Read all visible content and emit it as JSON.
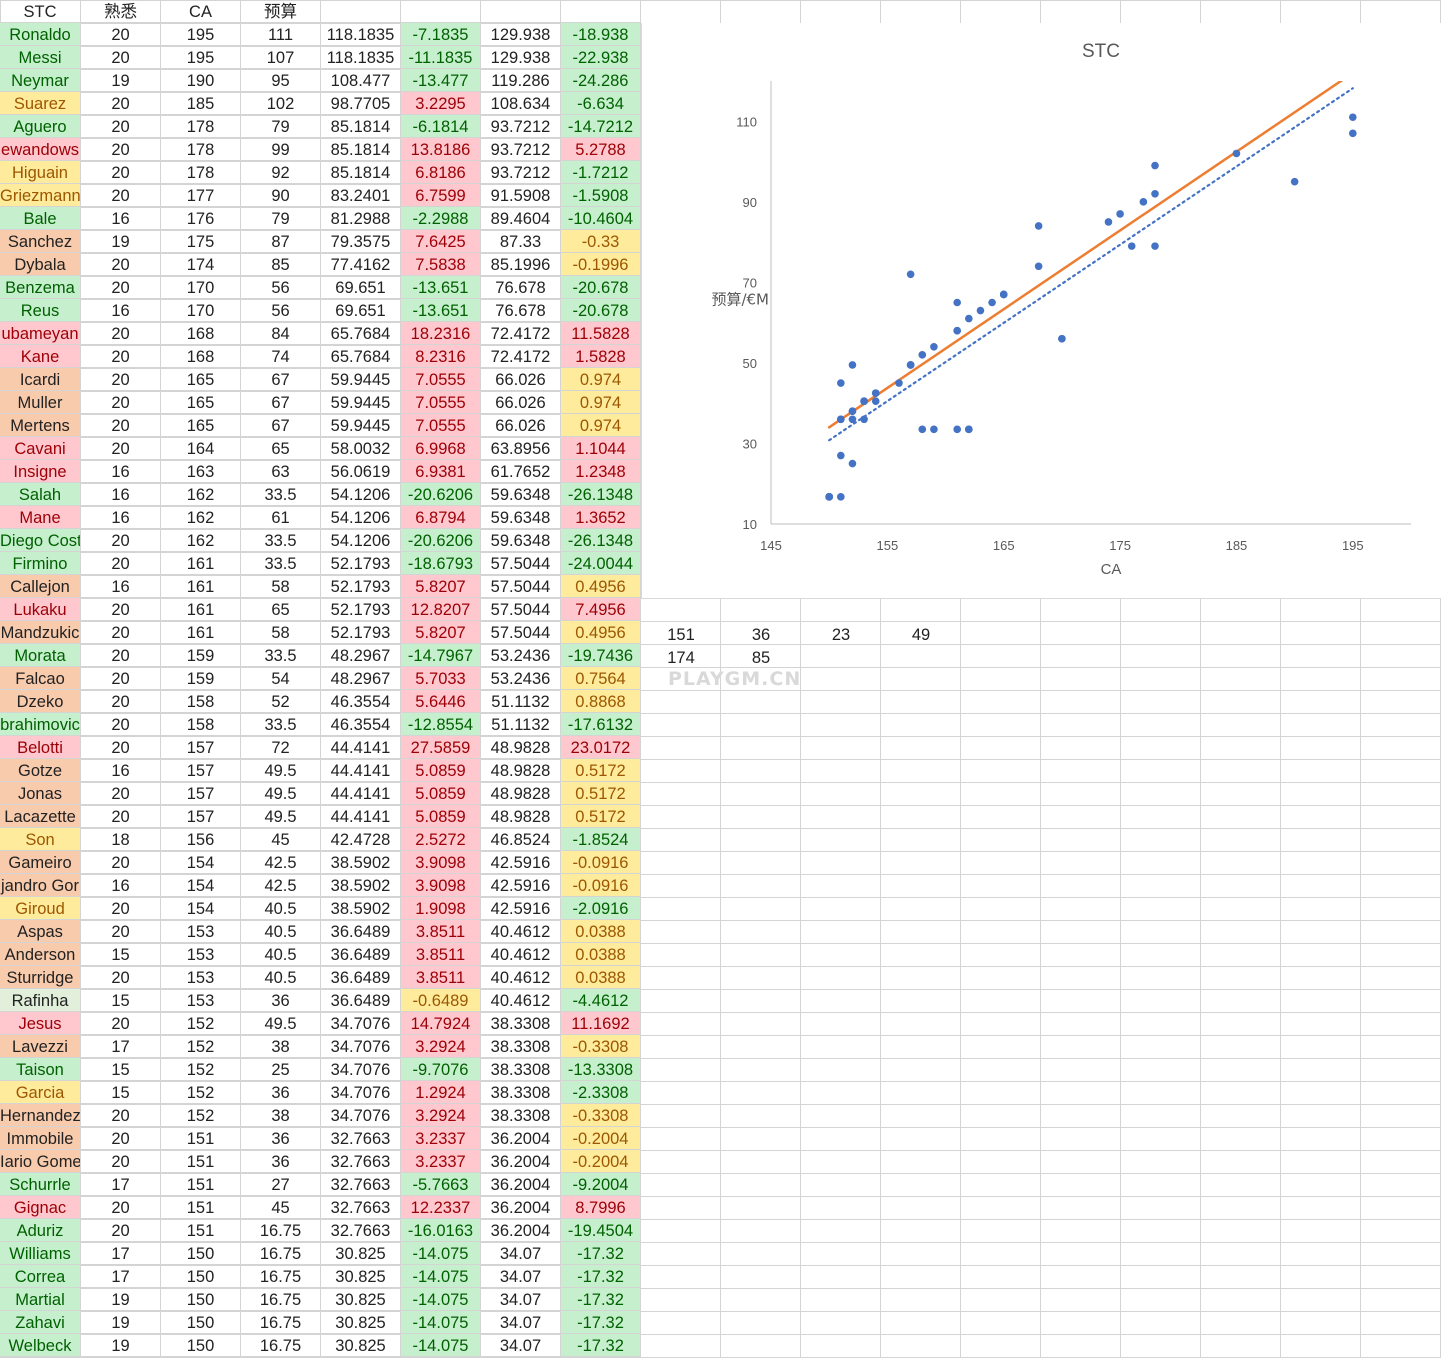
{
  "header": [
    "STC",
    "熟悉",
    "CA",
    "预算",
    "",
    "",
    "",
    ""
  ],
  "rows": [
    {
      "name": "Ronaldo",
      "fam": "20",
      "ca": "195",
      "budget": "111",
      "v1": "118.1835",
      "d1": "-7.1835",
      "v2": "129.938",
      "d2": "-18.938",
      "nc": "g",
      "d1c": "g",
      "d2c": "g"
    },
    {
      "name": "Messi",
      "fam": "20",
      "ca": "195",
      "budget": "107",
      "v1": "118.1835",
      "d1": "-11.1835",
      "v2": "129.938",
      "d2": "-22.938",
      "nc": "g",
      "d1c": "g",
      "d2c": "g"
    },
    {
      "name": "Neymar",
      "fam": "19",
      "ca": "190",
      "budget": "95",
      "v1": "108.477",
      "d1": "-13.477",
      "v2": "119.286",
      "d2": "-24.286",
      "nc": "g",
      "d1c": "g",
      "d2c": "g"
    },
    {
      "name": "Suarez",
      "fam": "20",
      "ca": "185",
      "budget": "102",
      "v1": "98.7705",
      "d1": "3.2295",
      "v2": "108.634",
      "d2": "-6.634",
      "nc": "y",
      "d1c": "r",
      "d2c": "g"
    },
    {
      "name": "Aguero",
      "fam": "20",
      "ca": "178",
      "budget": "79",
      "v1": "85.1814",
      "d1": "-6.1814",
      "v2": "93.7212",
      "d2": "-14.7212",
      "nc": "g",
      "d1c": "g",
      "d2c": "g"
    },
    {
      "name": "ewandows",
      "fam": "20",
      "ca": "178",
      "budget": "99",
      "v1": "85.1814",
      "d1": "13.8186",
      "v2": "93.7212",
      "d2": "5.2788",
      "nc": "r",
      "d1c": "r",
      "d2c": "r"
    },
    {
      "name": "Higuain",
      "fam": "20",
      "ca": "178",
      "budget": "92",
      "v1": "85.1814",
      "d1": "6.8186",
      "v2": "93.7212",
      "d2": "-1.7212",
      "nc": "y",
      "d1c": "r",
      "d2c": "g"
    },
    {
      "name": "Griezmann",
      "fam": "20",
      "ca": "177",
      "budget": "90",
      "v1": "83.2401",
      "d1": "6.7599",
      "v2": "91.5908",
      "d2": "-1.5908",
      "nc": "y",
      "d1c": "r",
      "d2c": "g"
    },
    {
      "name": "Bale",
      "fam": "16",
      "ca": "176",
      "budget": "79",
      "v1": "81.2988",
      "d1": "-2.2988",
      "v2": "89.4604",
      "d2": "-10.4604",
      "nc": "g",
      "d1c": "g",
      "d2c": "g"
    },
    {
      "name": "Sanchez",
      "fam": "19",
      "ca": "175",
      "budget": "87",
      "v1": "79.3575",
      "d1": "7.6425",
      "v2": "87.33",
      "d2": "-0.33",
      "nc": "o",
      "d1c": "r",
      "d2c": "y"
    },
    {
      "name": "Dybala",
      "fam": "20",
      "ca": "174",
      "budget": "85",
      "v1": "77.4162",
      "d1": "7.5838",
      "v2": "85.1996",
      "d2": "-0.1996",
      "nc": "o",
      "d1c": "r",
      "d2c": "y"
    },
    {
      "name": "Benzema",
      "fam": "20",
      "ca": "170",
      "budget": "56",
      "v1": "69.651",
      "d1": "-13.651",
      "v2": "76.678",
      "d2": "-20.678",
      "nc": "g",
      "d1c": "g",
      "d2c": "g"
    },
    {
      "name": "Reus",
      "fam": "16",
      "ca": "170",
      "budget": "56",
      "v1": "69.651",
      "d1": "-13.651",
      "v2": "76.678",
      "d2": "-20.678",
      "nc": "g",
      "d1c": "g",
      "d2c": "g"
    },
    {
      "name": "ubameyan",
      "fam": "20",
      "ca": "168",
      "budget": "84",
      "v1": "65.7684",
      "d1": "18.2316",
      "v2": "72.4172",
      "d2": "11.5828",
      "nc": "r",
      "d1c": "r",
      "d2c": "r"
    },
    {
      "name": "Kane",
      "fam": "20",
      "ca": "168",
      "budget": "74",
      "v1": "65.7684",
      "d1": "8.2316",
      "v2": "72.4172",
      "d2": "1.5828",
      "nc": "r",
      "d1c": "r",
      "d2c": "r"
    },
    {
      "name": "Icardi",
      "fam": "20",
      "ca": "165",
      "budget": "67",
      "v1": "59.9445",
      "d1": "7.0555",
      "v2": "66.026",
      "d2": "0.974",
      "nc": "o",
      "d1c": "r",
      "d2c": "y"
    },
    {
      "name": "Muller",
      "fam": "20",
      "ca": "165",
      "budget": "67",
      "v1": "59.9445",
      "d1": "7.0555",
      "v2": "66.026",
      "d2": "0.974",
      "nc": "o",
      "d1c": "r",
      "d2c": "y"
    },
    {
      "name": "Mertens",
      "fam": "20",
      "ca": "165",
      "budget": "67",
      "v1": "59.9445",
      "d1": "7.0555",
      "v2": "66.026",
      "d2": "0.974",
      "nc": "o",
      "d1c": "r",
      "d2c": "y"
    },
    {
      "name": "Cavani",
      "fam": "20",
      "ca": "164",
      "budget": "65",
      "v1": "58.0032",
      "d1": "6.9968",
      "v2": "63.8956",
      "d2": "1.1044",
      "nc": "r",
      "d1c": "r",
      "d2c": "r"
    },
    {
      "name": "Insigne",
      "fam": "16",
      "ca": "163",
      "budget": "63",
      "v1": "56.0619",
      "d1": "6.9381",
      "v2": "61.7652",
      "d2": "1.2348",
      "nc": "r",
      "d1c": "r",
      "d2c": "r"
    },
    {
      "name": "Salah",
      "fam": "16",
      "ca": "162",
      "budget": "33.5",
      "v1": "54.1206",
      "d1": "-20.6206",
      "v2": "59.6348",
      "d2": "-26.1348",
      "nc": "g",
      "d1c": "g",
      "d2c": "g"
    },
    {
      "name": "Mane",
      "fam": "16",
      "ca": "162",
      "budget": "61",
      "v1": "54.1206",
      "d1": "6.8794",
      "v2": "59.6348",
      "d2": "1.3652",
      "nc": "r",
      "d1c": "r",
      "d2c": "r"
    },
    {
      "name": "Diego Cost",
      "fam": "20",
      "ca": "162",
      "budget": "33.5",
      "v1": "54.1206",
      "d1": "-20.6206",
      "v2": "59.6348",
      "d2": "-26.1348",
      "nc": "g",
      "d1c": "g",
      "d2c": "g"
    },
    {
      "name": "Firmino",
      "fam": "20",
      "ca": "161",
      "budget": "33.5",
      "v1": "52.1793",
      "d1": "-18.6793",
      "v2": "57.5044",
      "d2": "-24.0044",
      "nc": "g",
      "d1c": "g",
      "d2c": "g"
    },
    {
      "name": "Callejon",
      "fam": "16",
      "ca": "161",
      "budget": "58",
      "v1": "52.1793",
      "d1": "5.8207",
      "v2": "57.5044",
      "d2": "0.4956",
      "nc": "o",
      "d1c": "r",
      "d2c": "y"
    },
    {
      "name": "Lukaku",
      "fam": "20",
      "ca": "161",
      "budget": "65",
      "v1": "52.1793",
      "d1": "12.8207",
      "v2": "57.5044",
      "d2": "7.4956",
      "nc": "r",
      "d1c": "r",
      "d2c": "r"
    },
    {
      "name": "Mandzukic",
      "fam": "20",
      "ca": "161",
      "budget": "58",
      "v1": "52.1793",
      "d1": "5.8207",
      "v2": "57.5044",
      "d2": "0.4956",
      "nc": "o",
      "d1c": "r",
      "d2c": "y"
    },
    {
      "name": "Morata",
      "fam": "20",
      "ca": "159",
      "budget": "33.5",
      "v1": "48.2967",
      "d1": "-14.7967",
      "v2": "53.2436",
      "d2": "-19.7436",
      "nc": "g",
      "d1c": "g",
      "d2c": "g"
    },
    {
      "name": "Falcao",
      "fam": "20",
      "ca": "159",
      "budget": "54",
      "v1": "48.2967",
      "d1": "5.7033",
      "v2": "53.2436",
      "d2": "0.7564",
      "nc": "o",
      "d1c": "r",
      "d2c": "y"
    },
    {
      "name": "Dzeko",
      "fam": "20",
      "ca": "158",
      "budget": "52",
      "v1": "46.3554",
      "d1": "5.6446",
      "v2": "51.1132",
      "d2": "0.8868",
      "nc": "o",
      "d1c": "r",
      "d2c": "y"
    },
    {
      "name": "brahimovic",
      "fam": "20",
      "ca": "158",
      "budget": "33.5",
      "v1": "46.3554",
      "d1": "-12.8554",
      "v2": "51.1132",
      "d2": "-17.6132",
      "nc": "g",
      "d1c": "g",
      "d2c": "g"
    },
    {
      "name": "Belotti",
      "fam": "20",
      "ca": "157",
      "budget": "72",
      "v1": "44.4141",
      "d1": "27.5859",
      "v2": "48.9828",
      "d2": "23.0172",
      "nc": "r",
      "d1c": "r",
      "d2c": "r"
    },
    {
      "name": "Gotze",
      "fam": "16",
      "ca": "157",
      "budget": "49.5",
      "v1": "44.4141",
      "d1": "5.0859",
      "v2": "48.9828",
      "d2": "0.5172",
      "nc": "o",
      "d1c": "r",
      "d2c": "y"
    },
    {
      "name": "Jonas",
      "fam": "20",
      "ca": "157",
      "budget": "49.5",
      "v1": "44.4141",
      "d1": "5.0859",
      "v2": "48.9828",
      "d2": "0.5172",
      "nc": "o",
      "d1c": "r",
      "d2c": "y"
    },
    {
      "name": "Lacazette",
      "fam": "20",
      "ca": "157",
      "budget": "49.5",
      "v1": "44.4141",
      "d1": "5.0859",
      "v2": "48.9828",
      "d2": "0.5172",
      "nc": "o",
      "d1c": "r",
      "d2c": "y"
    },
    {
      "name": "Son",
      "fam": "18",
      "ca": "156",
      "budget": "45",
      "v1": "42.4728",
      "d1": "2.5272",
      "v2": "46.8524",
      "d2": "-1.8524",
      "nc": "y",
      "d1c": "r",
      "d2c": "g"
    },
    {
      "name": "Gameiro",
      "fam": "20",
      "ca": "154",
      "budget": "42.5",
      "v1": "38.5902",
      "d1": "3.9098",
      "v2": "42.5916",
      "d2": "-0.0916",
      "nc": "o",
      "d1c": "r",
      "d2c": "y"
    },
    {
      "name": "jandro Gor",
      "fam": "16",
      "ca": "154",
      "budget": "42.5",
      "v1": "38.5902",
      "d1": "3.9098",
      "v2": "42.5916",
      "d2": "-0.0916",
      "nc": "o",
      "d1c": "r",
      "d2c": "y"
    },
    {
      "name": "Giroud",
      "fam": "20",
      "ca": "154",
      "budget": "40.5",
      "v1": "38.5902",
      "d1": "1.9098",
      "v2": "42.5916",
      "d2": "-2.0916",
      "nc": "y",
      "d1c": "r",
      "d2c": "g"
    },
    {
      "name": "Aspas",
      "fam": "20",
      "ca": "153",
      "budget": "40.5",
      "v1": "36.6489",
      "d1": "3.8511",
      "v2": "40.4612",
      "d2": "0.0388",
      "nc": "o",
      "d1c": "r",
      "d2c": "y"
    },
    {
      "name": "Anderson",
      "fam": "15",
      "ca": "153",
      "budget": "40.5",
      "v1": "36.6489",
      "d1": "3.8511",
      "v2": "40.4612",
      "d2": "0.0388",
      "nc": "o",
      "d1c": "r",
      "d2c": "y"
    },
    {
      "name": "Sturridge",
      "fam": "20",
      "ca": "153",
      "budget": "40.5",
      "v1": "36.6489",
      "d1": "3.8511",
      "v2": "40.4612",
      "d2": "0.0388",
      "nc": "o",
      "d1c": "r",
      "d2c": "y"
    },
    {
      "name": "Rafinha",
      "fam": "15",
      "ca": "153",
      "budget": "36",
      "v1": "36.6489",
      "d1": "-0.6489",
      "v2": "40.4612",
      "d2": "-4.4612",
      "nc": "lg",
      "d1c": "y",
      "d2c": "g"
    },
    {
      "name": "Jesus",
      "fam": "20",
      "ca": "152",
      "budget": "49.5",
      "v1": "34.7076",
      "d1": "14.7924",
      "v2": "38.3308",
      "d2": "11.1692",
      "nc": "r",
      "d1c": "r",
      "d2c": "r"
    },
    {
      "name": "Lavezzi",
      "fam": "17",
      "ca": "152",
      "budget": "38",
      "v1": "34.7076",
      "d1": "3.2924",
      "v2": "38.3308",
      "d2": "-0.3308",
      "nc": "o",
      "d1c": "r",
      "d2c": "y"
    },
    {
      "name": "Taison",
      "fam": "15",
      "ca": "152",
      "budget": "25",
      "v1": "34.7076",
      "d1": "-9.7076",
      "v2": "38.3308",
      "d2": "-13.3308",
      "nc": "g",
      "d1c": "g",
      "d2c": "g"
    },
    {
      "name": "Garcia",
      "fam": "15",
      "ca": "152",
      "budget": "36",
      "v1": "34.7076",
      "d1": "1.2924",
      "v2": "38.3308",
      "d2": "-2.3308",
      "nc": "y",
      "d1c": "r",
      "d2c": "g"
    },
    {
      "name": "Hernandez",
      "fam": "20",
      "ca": "152",
      "budget": "38",
      "v1": "34.7076",
      "d1": "3.2924",
      "v2": "38.3308",
      "d2": "-0.3308",
      "nc": "o",
      "d1c": "r",
      "d2c": "y"
    },
    {
      "name": "Immobile",
      "fam": "20",
      "ca": "151",
      "budget": "36",
      "v1": "32.7663",
      "d1": "3.2337",
      "v2": "36.2004",
      "d2": "-0.2004",
      "nc": "o",
      "d1c": "r",
      "d2c": "y"
    },
    {
      "name": "Iario Gome",
      "fam": "20",
      "ca": "151",
      "budget": "36",
      "v1": "32.7663",
      "d1": "3.2337",
      "v2": "36.2004",
      "d2": "-0.2004",
      "nc": "o",
      "d1c": "r",
      "d2c": "y"
    },
    {
      "name": "Schurrle",
      "fam": "17",
      "ca": "151",
      "budget": "27",
      "v1": "32.7663",
      "d1": "-5.7663",
      "v2": "36.2004",
      "d2": "-9.2004",
      "nc": "g",
      "d1c": "g",
      "d2c": "g"
    },
    {
      "name": "Gignac",
      "fam": "20",
      "ca": "151",
      "budget": "45",
      "v1": "32.7663",
      "d1": "12.2337",
      "v2": "36.2004",
      "d2": "8.7996",
      "nc": "r",
      "d1c": "r",
      "d2c": "r"
    },
    {
      "name": "Aduriz",
      "fam": "20",
      "ca": "151",
      "budget": "16.75",
      "v1": "32.7663",
      "d1": "-16.0163",
      "v2": "36.2004",
      "d2": "-19.4504",
      "nc": "g",
      "d1c": "g",
      "d2c": "g"
    },
    {
      "name": "Williams",
      "fam": "17",
      "ca": "150",
      "budget": "16.75",
      "v1": "30.825",
      "d1": "-14.075",
      "v2": "34.07",
      "d2": "-17.32",
      "nc": "g",
      "d1c": "g",
      "d2c": "g"
    },
    {
      "name": "Correa",
      "fam": "17",
      "ca": "150",
      "budget": "16.75",
      "v1": "30.825",
      "d1": "-14.075",
      "v2": "34.07",
      "d2": "-17.32",
      "nc": "g",
      "d1c": "g",
      "d2c": "g"
    },
    {
      "name": "Martial",
      "fam": "19",
      "ca": "150",
      "budget": "16.75",
      "v1": "30.825",
      "d1": "-14.075",
      "v2": "34.07",
      "d2": "-17.32",
      "nc": "g",
      "d1c": "g",
      "d2c": "g"
    },
    {
      "name": "Zahavi",
      "fam": "19",
      "ca": "150",
      "budget": "16.75",
      "v1": "30.825",
      "d1": "-14.075",
      "v2": "34.07",
      "d2": "-17.32",
      "nc": "g",
      "d1c": "g",
      "d2c": "g"
    },
    {
      "name": "Welbeck",
      "fam": "19",
      "ca": "150",
      "budget": "16.75",
      "v1": "30.825",
      "d1": "-14.075",
      "v2": "34.07",
      "d2": "-17.32",
      "nc": "g",
      "d1c": "g",
      "d2c": "g"
    }
  ],
  "extra_cells": {
    "r1": [
      "151",
      "36",
      "23",
      "49"
    ],
    "r2": [
      "174",
      "85"
    ]
  },
  "watermark": "PLAYGM.CN",
  "chart_data": {
    "type": "scatter",
    "title": "STC",
    "xlabel": "CA",
    "ylabel": "预算/€M",
    "xlim": [
      145,
      200
    ],
    "ylim": [
      10,
      120
    ],
    "xticks": [
      "145",
      "155",
      "165",
      "175",
      "185",
      "195"
    ],
    "yticks": [
      "10",
      "30",
      "50",
      "70",
      "90",
      "110"
    ],
    "grid": false,
    "legend": "none",
    "series": [
      {
        "x": [
          195,
          195,
          190,
          185,
          178,
          178,
          178,
          177,
          176,
          175,
          174,
          170,
          170,
          168,
          168,
          165,
          165,
          165,
          164,
          163,
          162,
          162,
          162,
          161,
          161,
          161,
          161,
          159,
          159,
          158,
          158,
          157,
          157,
          157,
          157,
          156,
          154,
          154,
          154,
          153,
          153,
          153,
          153,
          152,
          152,
          152,
          152,
          152,
          151,
          151,
          151,
          151,
          151,
          150,
          150,
          150,
          150,
          150
        ],
        "y": [
          111,
          107,
          95,
          102,
          79,
          99,
          92,
          90,
          79,
          87,
          85,
          56,
          56,
          84,
          74,
          67,
          67,
          67,
          65,
          63,
          33.5,
          61,
          33.5,
          33.5,
          58,
          65,
          58,
          33.5,
          54,
          52,
          33.5,
          72,
          49.5,
          49.5,
          49.5,
          45,
          42.5,
          42.5,
          40.5,
          40.5,
          40.5,
          40.5,
          36,
          49.5,
          38,
          25,
          36,
          38,
          36,
          36,
          27,
          45,
          16.75,
          16.75,
          16.75,
          16.75,
          16.75,
          16.75
        ],
        "color": "#4472c4"
      }
    ],
    "trendlines": [
      {
        "style": "solid",
        "color": "#ed7d31",
        "points": [
          [
            150,
            34
          ],
          [
            195,
            122
          ]
        ]
      },
      {
        "style": "dotted",
        "color": "#4472c4",
        "points": [
          [
            150,
            30.8
          ],
          [
            195,
            118.2
          ]
        ]
      }
    ]
  }
}
